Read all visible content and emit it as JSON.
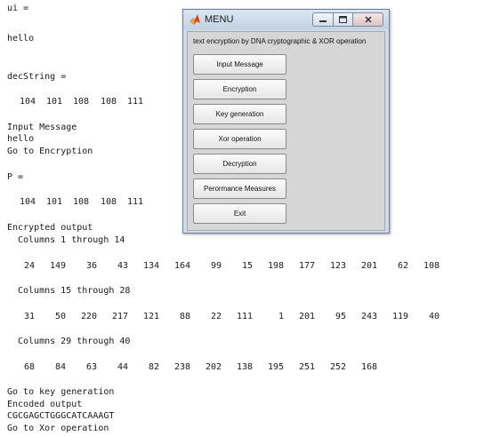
{
  "console": {
    "l1": "ui =",
    "l2": "hello",
    "l3": "decString =",
    "l4_values": [
      "104",
      "101",
      "108",
      "108",
      "111"
    ],
    "l5": "Input Message",
    "l6": "hello",
    "l7": "Go to Encryption",
    "l8": "P =",
    "l9_values": [
      "104",
      "101",
      "108",
      "108",
      "111"
    ],
    "l10": "Encrypted output",
    "cols1": "Columns 1 through 14",
    "row1": [
      "24",
      "149",
      "36",
      "43",
      "134",
      "164",
      "99",
      "15",
      "198",
      "177",
      "123",
      "201",
      "62",
      "108"
    ],
    "cols2": "Columns 15 through 28",
    "row2": [
      "31",
      "50",
      "220",
      "217",
      "121",
      "88",
      "22",
      "111",
      "1",
      "201",
      "95",
      "243",
      "119",
      "40"
    ],
    "cols3": "Columns 29 through 40",
    "row3": [
      "68",
      "84",
      "63",
      "44",
      "82",
      "238",
      "202",
      "138",
      "195",
      "251",
      "252",
      "168"
    ],
    "l11": "Go to key generation",
    "l12": "Encoded output",
    "l13": "CGCGAGCTGGGCATCAAAGT",
    "l14": "Go to Xor operation"
  },
  "window": {
    "title": "MENU",
    "icon": "matlab-icon",
    "heading": "text encryption by DNA cryptographic & XOR operation",
    "buttons": {
      "input": "Input Message",
      "encryption": "Encryption",
      "keygen": "Key generation",
      "xor": "Xor operation",
      "decryption": "Decryption",
      "performance": "Perormance Measures",
      "exit": "Exit"
    }
  }
}
